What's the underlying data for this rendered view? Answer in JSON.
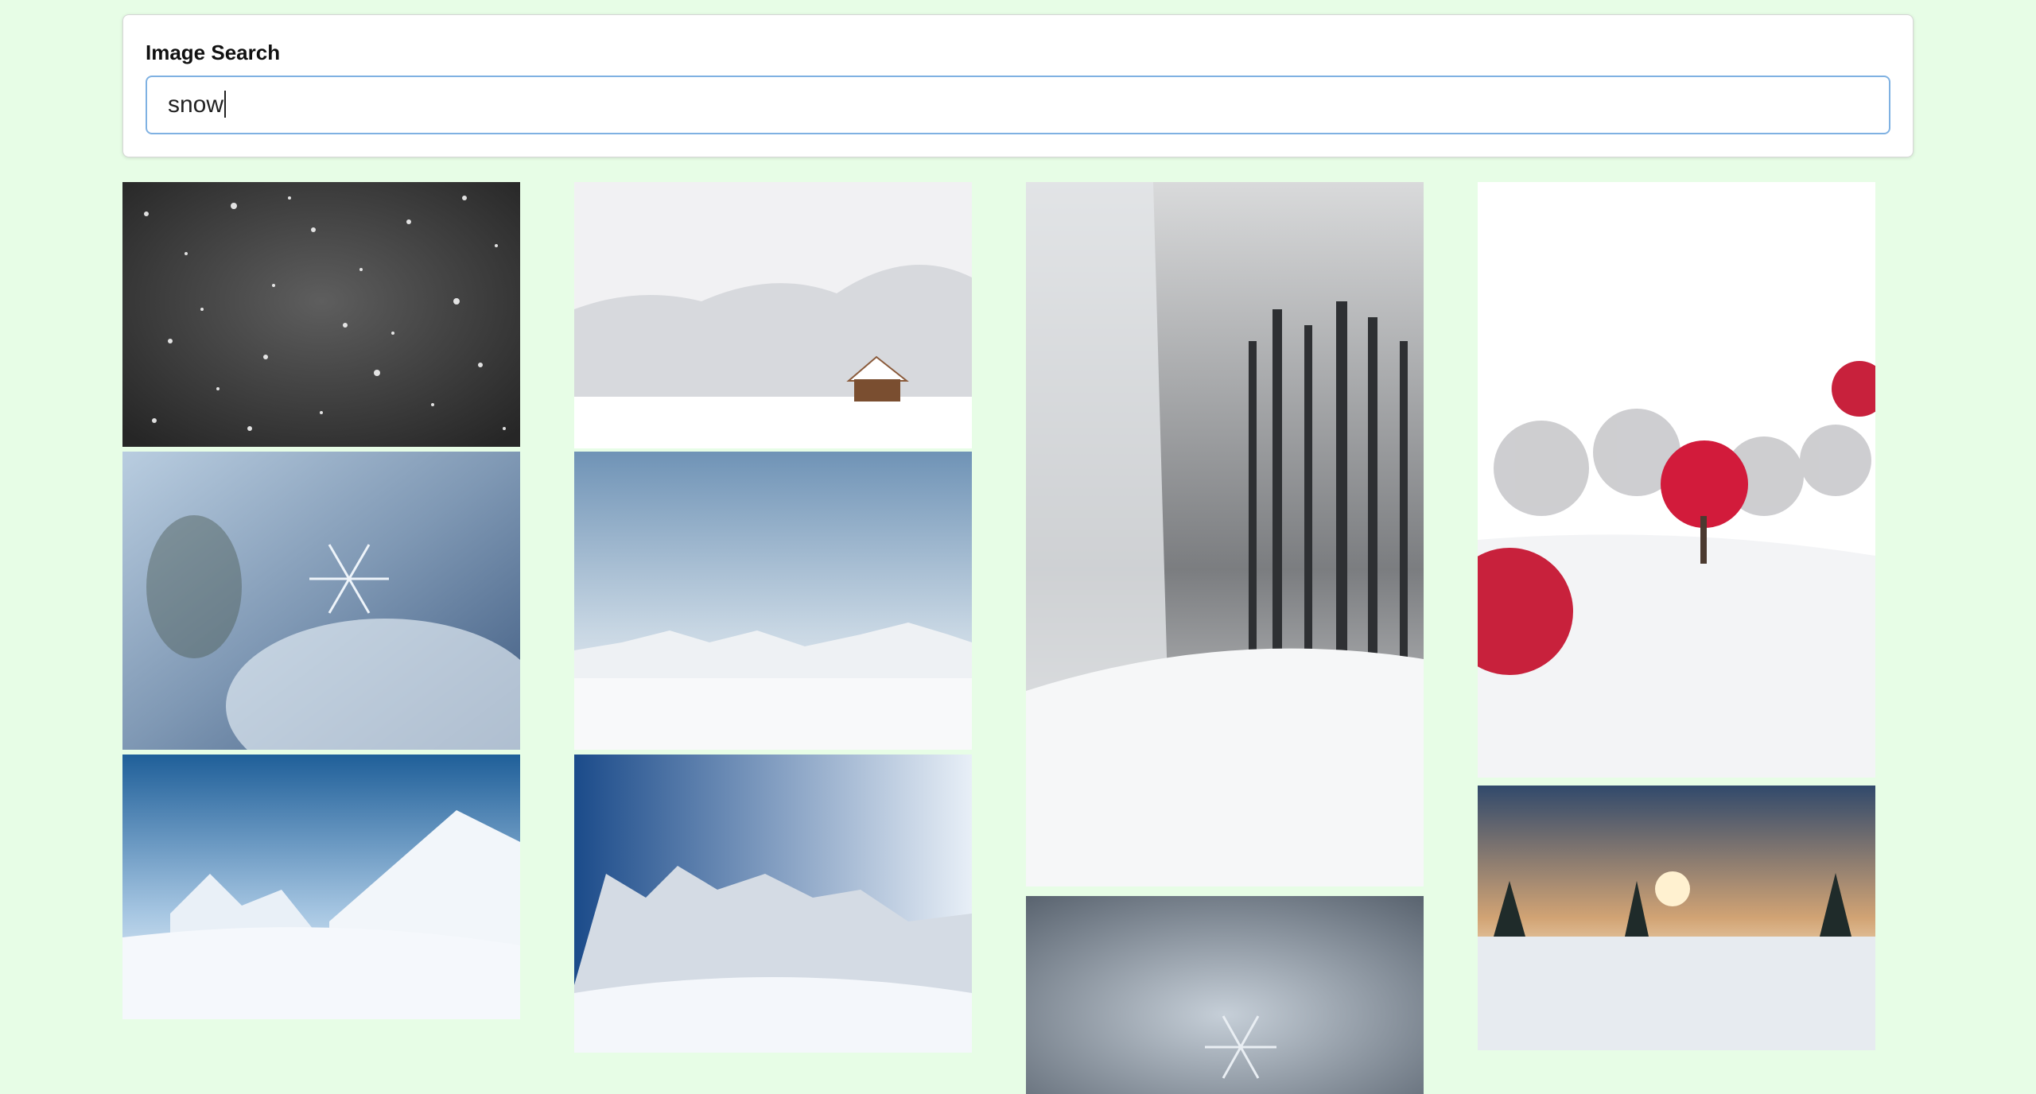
{
  "search": {
    "title": "Image Search",
    "query": "snow"
  },
  "results": [
    {
      "name": "falling-snow-image",
      "subject": "falling snowflakes on dark background"
    },
    {
      "name": "snowy-cabin-image",
      "subject": "small cabin in snowy forest"
    },
    {
      "name": "snowy-forest-road-image",
      "subject": "road through snow-covered pine forest"
    },
    {
      "name": "red-tree-snow-park-image",
      "subject": "red tree in snowy park"
    },
    {
      "name": "snowflake-closeup-image",
      "subject": "snowflake close-up"
    },
    {
      "name": "snowy-plain-mountains-image",
      "subject": "snowy plain with distant mountains"
    },
    {
      "name": "blue-mountains-snow-image",
      "subject": "blue sky over snowy mountains"
    },
    {
      "name": "alpine-ski-valley-image",
      "subject": "alpine valley with snowy peaks"
    },
    {
      "name": "blurred-snowflake-image",
      "subject": "blurred snowflake"
    },
    {
      "name": "sunset-snow-trees-image",
      "subject": "sunset behind snowy pine trees"
    }
  ]
}
